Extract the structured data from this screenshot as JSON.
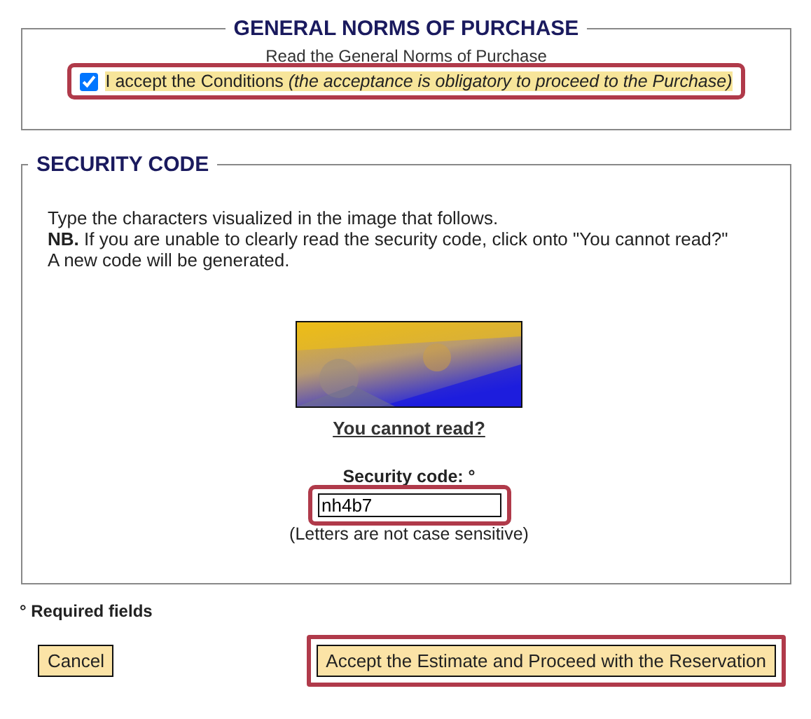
{
  "norms": {
    "title": "GENERAL NORMS OF PURCHASE",
    "link": "Read the General Norms of Purchase",
    "accept": {
      "label": "I accept the Conditions *(the acceptance is obligatory to proceed to the Purchase)*",
      "checked": true,
      "highlighted": true
    }
  },
  "security": {
    "title": "SECURITY CODE",
    "instructions": "Type the characters visualized in the image that follows.",
    "nb": "**NB.** If you are unable to clearly read the security code, click onto \"You cannot read?\" A new code will be generated.",
    "refresh_link": "You cannot read?",
    "field_label": "Security code: °",
    "field": {
      "value": "nh4b7",
      "highlighted": true
    },
    "hint": "(Letters are not case sensitive)"
  },
  "required_note": "° Required fields",
  "buttons": [
    {
      "label": "Cancel",
      "highlighted": false
    },
    {
      "label": "Accept the Estimate and Proceed with the Reservation",
      "highlighted": true
    }
  ]
}
